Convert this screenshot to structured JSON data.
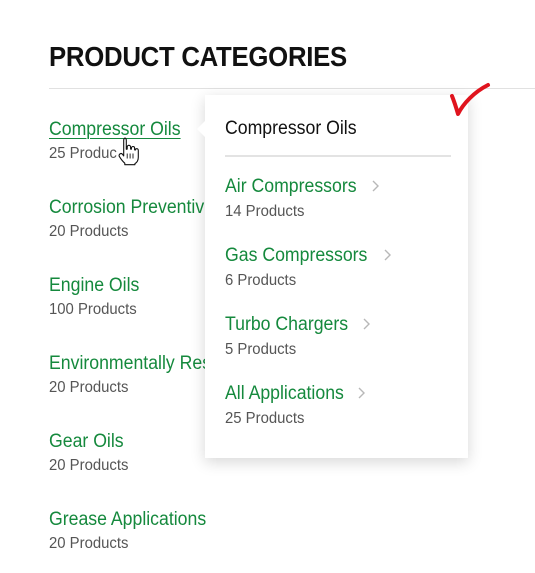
{
  "heading": "PRODUCT CATEGORIES",
  "categories": [
    {
      "name": "Compressor Oils",
      "count": "25 Produc",
      "active": true
    },
    {
      "name": "Corrosion Preventiv",
      "count": "20 Products"
    },
    {
      "name": "Engine Oils",
      "count": "100 Products"
    },
    {
      "name": "Environmentally Res",
      "count": "20 Products"
    },
    {
      "name": "Gear Oils",
      "count": "20 Products"
    },
    {
      "name": "Grease Applications",
      "count": "20 Products"
    }
  ],
  "flyout": {
    "title": "Compressor Oils",
    "items": [
      {
        "name": "Air Compressors",
        "count": "14 Products",
        "icon": "chevron-right-icon"
      },
      {
        "name": "Gas Compressors",
        "count": "6 Products",
        "icon": "chevron-right-icon"
      },
      {
        "name": "Turbo Chargers",
        "count": "5 Products",
        "icon": "chevron-right-icon"
      },
      {
        "name": "All Applications",
        "count": "25 Products",
        "icon": "chevron-right-icon"
      }
    ]
  },
  "icons": {
    "cursor": "hand-pointer-icon",
    "check": "checkmark-icon"
  },
  "colors": {
    "link": "#15893d",
    "heading": "#111111",
    "count": "#555555",
    "check": "#e0141e"
  }
}
